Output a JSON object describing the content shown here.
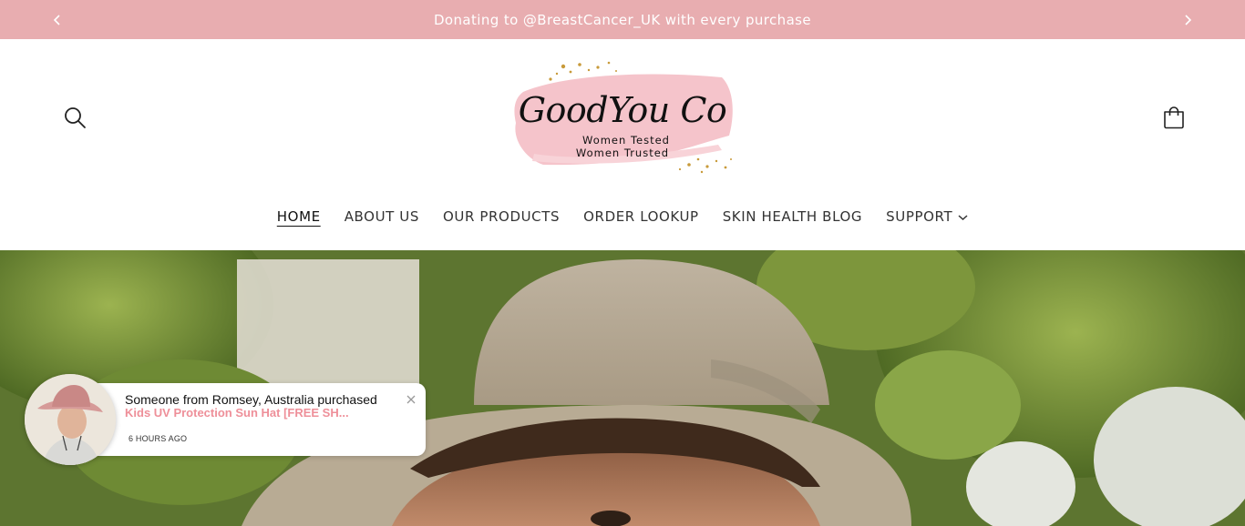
{
  "announcement": {
    "text": "Donating to @BreastCancer_UK with every purchase",
    "prev_icon": "chevron-left-icon",
    "next_icon": "chevron-right-icon"
  },
  "header": {
    "search_icon": "search-icon",
    "cart_icon": "shopping-bag-icon",
    "logo": {
      "brand": "GoodYou Co",
      "tagline_1": "Women Tested",
      "tagline_2": "Women Trusted"
    }
  },
  "nav": {
    "items": [
      {
        "label": "HOME"
      },
      {
        "label": "ABOUT US"
      },
      {
        "label": "OUR PRODUCTS"
      },
      {
        "label": "ORDER LOOKUP"
      },
      {
        "label": "SKIN HEALTH BLOG"
      },
      {
        "label": "SUPPORT"
      }
    ]
  },
  "popup": {
    "message": "Someone from Romsey, Australia purchased",
    "product": "Kids UV Protection Sun Hat [FREE SH...",
    "time": "6 HOURS AGO",
    "close_icon": "close-icon"
  },
  "colors": {
    "announcement_bg": "#e8adb0",
    "popup_product": "#ee8f99"
  }
}
